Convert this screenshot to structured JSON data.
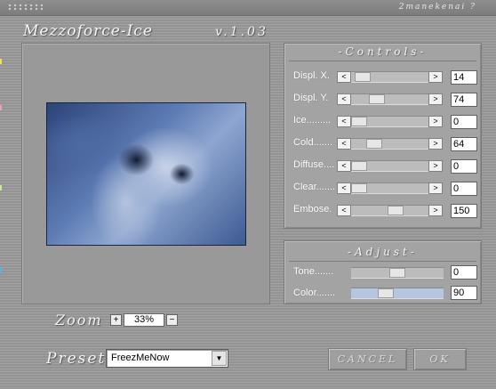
{
  "window": {
    "credit": "2manekenai ?",
    "help_glyph": "?"
  },
  "app": {
    "title": "Mezzoforce-Ice",
    "version": "v.1.03"
  },
  "preview": {
    "description": "preview-image"
  },
  "controls": {
    "title": "-Controls-",
    "sliders": [
      {
        "label": "Displ. X.",
        "value": "14",
        "level": 0.06
      },
      {
        "label": "Displ. Y.",
        "value": "74",
        "level": 0.29
      },
      {
        "label": "Ice.........",
        "value": "0",
        "level": 0.0
      },
      {
        "label": "Cold.......",
        "value": "64",
        "level": 0.25
      },
      {
        "label": "Diffuse....",
        "value": "0",
        "level": 0.0
      },
      {
        "label": "Clear.......",
        "value": "0",
        "level": 0.0
      },
      {
        "label": "Embose.",
        "value": "150",
        "level": 0.59
      }
    ]
  },
  "adjust": {
    "title": "-Adjust-",
    "sliders": [
      {
        "label": "Tone.......",
        "value": "0",
        "level": 0.5
      },
      {
        "label": "Color.......",
        "value": "90",
        "level": 0.35
      }
    ]
  },
  "arrows": {
    "left": "<",
    "right": ">"
  },
  "zoom": {
    "label": "Zoom",
    "plus": "+",
    "value": "33%",
    "minus": "−"
  },
  "preset": {
    "label": "Preset",
    "selected": "FreezMeNow",
    "arrow": "▼"
  },
  "buttons": {
    "cancel": "CANCEL",
    "ok": "OK"
  },
  "colors": {
    "background": "#9c9c9c",
    "panel": "#a3a3a3",
    "color_track": "#b4c6e0"
  }
}
